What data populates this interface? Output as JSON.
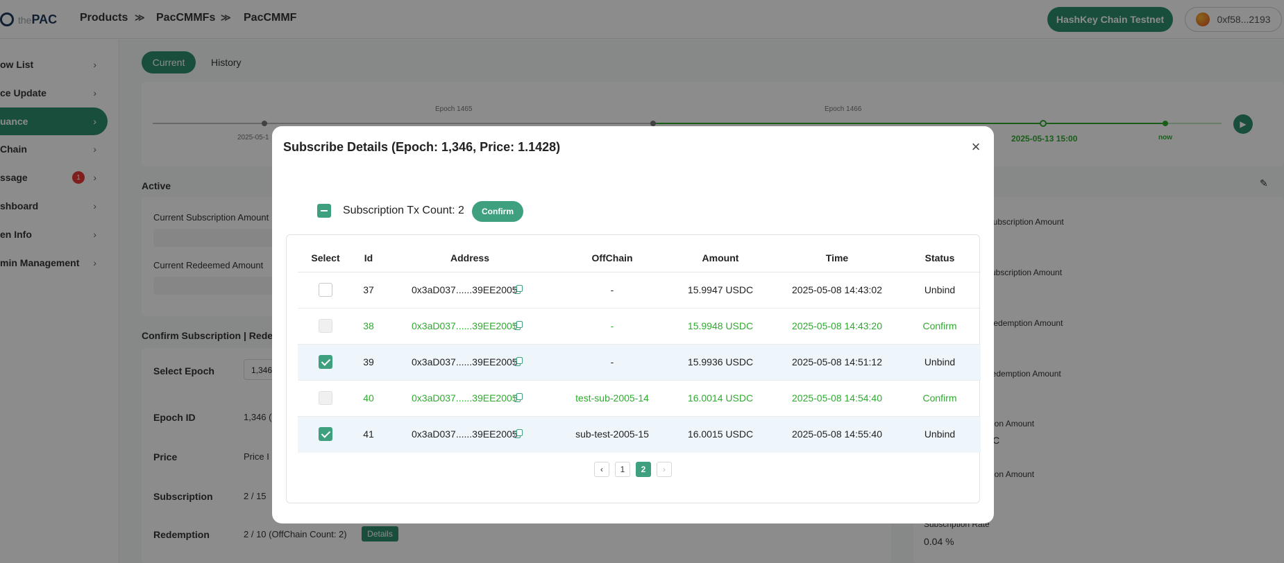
{
  "header": {
    "logo_prefix": "the",
    "logo_text": "PAC",
    "breadcrumb": [
      "Products",
      "PacCMMFs",
      "PacCMMF"
    ],
    "chain_button": "HashKey Chain Testnet",
    "wallet": "0xf58...2193"
  },
  "sidebar": {
    "items": [
      {
        "label": "ow List"
      },
      {
        "label": "ce Update"
      },
      {
        "label": "uance"
      },
      {
        "label": " Chain"
      },
      {
        "label": "ssage",
        "badge": "1"
      },
      {
        "label": "shboard"
      },
      {
        "label": "en Info"
      },
      {
        "label": "min Management"
      }
    ]
  },
  "main": {
    "tabs": [
      "Current",
      "History"
    ],
    "timeline": {
      "epoch_a": "Epoch 1465",
      "epoch_b": "Epoch 1466",
      "date_left": "2025-05-1",
      "date_current": "2025-05-13 15:00",
      "now": "now"
    },
    "active_title": "Active",
    "current_subscription_amount": "Current Subscription Amount",
    "current_redeemed_amount": "Current Redeemed Amount",
    "confirm_section_title": "Confirm Subscription | Redem",
    "select_epoch_label": "Select Epoch",
    "select_epoch_value": "1,346",
    "epoch_id_label": "Epoch ID",
    "epoch_id_value": "1,346 (",
    "price_label": "Price",
    "price_value": "Price I",
    "subscription_label": "Subscription",
    "subscription_value": "2 / 15",
    "redemption_label": "Redemption",
    "redemption_value": "2 / 10 (OffChain Count: 2)",
    "details_button": "Details",
    "right_labels": [
      "al Subscription Amount",
      "l Subscription Amount",
      "al Redemption Amount",
      "l Redemption Amount",
      "ption Amount",
      "ption Amount"
    ],
    "right_value_1": "DC",
    "subscription_rate_label": "Subscription Rate",
    "subscription_rate_value": "0.04 %"
  },
  "modal": {
    "title": "Subscribe Details (Epoch: 1,346, Price: 1.1428)",
    "close": "×",
    "tx_count": "Subscription Tx Count: 2",
    "confirm_button": "Confirm",
    "columns": [
      "Select",
      "Id",
      "Address",
      "OffChain",
      "Amount",
      "Time",
      "Status"
    ],
    "rows": [
      {
        "id": "37",
        "address": "0x3aD037......39EE2005",
        "offchain": "-",
        "amount": "15.9947 USDC",
        "time": "2025-05-08 14:43:02",
        "status": "Unbind"
      },
      {
        "id": "38",
        "address": "0x3aD037......39EE2005",
        "offchain": "-",
        "amount": "15.9948 USDC",
        "time": "2025-05-08 14:43:20",
        "status": "Confirm"
      },
      {
        "id": "39",
        "address": "0x3aD037......39EE2005",
        "offchain": "-",
        "amount": "15.9936 USDC",
        "time": "2025-05-08 14:51:12",
        "status": "Unbind"
      },
      {
        "id": "40",
        "address": "0x3aD037......39EE2005",
        "offchain": "test-sub-2005-14",
        "amount": "16.0014 USDC",
        "time": "2025-05-08 14:54:40",
        "status": "Confirm"
      },
      {
        "id": "41",
        "address": "0x3aD037......39EE2005",
        "offchain": "sub-test-2005-15",
        "amount": "16.0015 USDC",
        "time": "2025-05-08 14:55:40",
        "status": "Unbind"
      }
    ],
    "pagination": {
      "prev": "‹",
      "pages": [
        "1",
        "2"
      ],
      "current": "2",
      "next": "›"
    }
  },
  "colors": {
    "accent": "#2f8f6f",
    "confirmed_text": "#2eaa2e",
    "selected_row": "#eef5fb"
  }
}
